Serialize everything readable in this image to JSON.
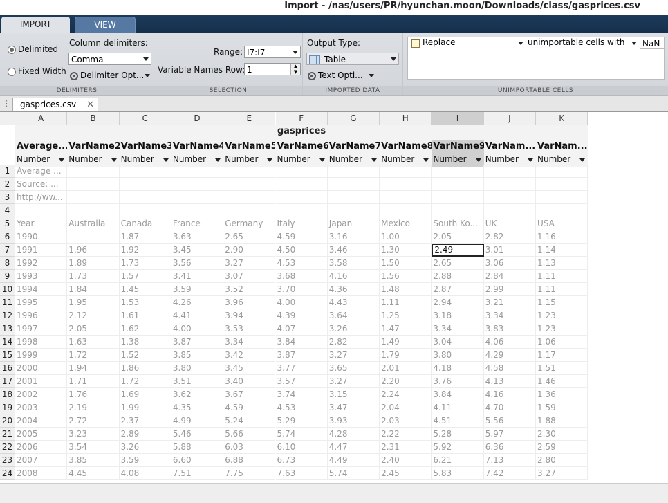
{
  "window": {
    "title": "Import - /nas/users/PR/hyunchan.moon/Downloads/class/gasprices.csv"
  },
  "tabs": [
    {
      "label": "IMPORT"
    },
    {
      "label": "VIEW"
    }
  ],
  "ribbon": {
    "delimiters": {
      "section_label": "DELIMITERS",
      "delimited_label": "Delimited",
      "fixed_width_label": "Fixed Width",
      "column_delimiters_label": "Column delimiters:",
      "column_delimiters_value": "Comma",
      "delimiter_options_label": "Delimiter Opt..."
    },
    "selection": {
      "section_label": "SELECTION",
      "range_label": "Range:",
      "range_value": "I7:I7",
      "var_names_row_label": "Variable Names Row:",
      "var_names_row_value": "1"
    },
    "imported_data": {
      "section_label": "IMPORTED DATA",
      "output_type_label": "Output Type:",
      "output_type_value": "Table",
      "text_options_label": "Text Opti..."
    },
    "unimportable": {
      "section_label": "UNIMPORTABLE CELLS",
      "replace_label": "Replace",
      "rule_label": "unimportable cells with",
      "value": "NaN"
    }
  },
  "document_tab": {
    "label": "gasprices.csv"
  },
  "grid": {
    "table_name": "gasprices",
    "columns": [
      "A",
      "B",
      "C",
      "D",
      "E",
      "F",
      "G",
      "H",
      "I",
      "J",
      "K"
    ],
    "selected_column": "I",
    "variable_names": [
      "Average...",
      "VarName2",
      "VarName3",
      "VarName4",
      "VarName5",
      "VarName6",
      "VarName7",
      "VarName8",
      "VarName9",
      "VarNam...",
      "VarNam..."
    ],
    "variable_types": [
      "Number",
      "Number",
      "Number",
      "Number",
      "Number",
      "Number",
      "Number",
      "Number",
      "Number",
      "Number",
      "Number"
    ],
    "selected_cell": "I7",
    "rows": [
      [
        "Average ...",
        "",
        "",
        "",
        "",
        "",
        "",
        "",
        "",
        "",
        ""
      ],
      [
        "Source: ...",
        "",
        "",
        "",
        "",
        "",
        "",
        "",
        "",
        "",
        ""
      ],
      [
        "http://ww...",
        "",
        "",
        "",
        "",
        "",
        "",
        "",
        "",
        "",
        ""
      ],
      [
        "",
        "",
        "",
        "",
        "",
        "",
        "",
        "",
        "",
        "",
        ""
      ],
      [
        "Year",
        "Australia",
        "Canada",
        "France",
        "Germany",
        "Italy",
        "Japan",
        "Mexico",
        "South Ko...",
        "UK",
        "USA"
      ],
      [
        "1990",
        "",
        "1.87",
        "3.63",
        "2.65",
        "4.59",
        "3.16",
        "1.00",
        "2.05",
        "2.82",
        "1.16"
      ],
      [
        "1991",
        "1.96",
        "1.92",
        "3.45",
        "2.90",
        "4.50",
        "3.46",
        "1.30",
        "2.49",
        "3.01",
        "1.14"
      ],
      [
        "1992",
        "1.89",
        "1.73",
        "3.56",
        "3.27",
        "4.53",
        "3.58",
        "1.50",
        "2.65",
        "3.06",
        "1.13"
      ],
      [
        "1993",
        "1.73",
        "1.57",
        "3.41",
        "3.07",
        "3.68",
        "4.16",
        "1.56",
        "2.88",
        "2.84",
        "1.11"
      ],
      [
        "1994",
        "1.84",
        "1.45",
        "3.59",
        "3.52",
        "3.70",
        "4.36",
        "1.48",
        "2.87",
        "2.99",
        "1.11"
      ],
      [
        "1995",
        "1.95",
        "1.53",
        "4.26",
        "3.96",
        "4.00",
        "4.43",
        "1.11",
        "2.94",
        "3.21",
        "1.15"
      ],
      [
        "1996",
        "2.12",
        "1.61",
        "4.41",
        "3.94",
        "4.39",
        "3.64",
        "1.25",
        "3.18",
        "3.34",
        "1.23"
      ],
      [
        "1997",
        "2.05",
        "1.62",
        "4.00",
        "3.53",
        "4.07",
        "3.26",
        "1.47",
        "3.34",
        "3.83",
        "1.23"
      ],
      [
        "1998",
        "1.63",
        "1.38",
        "3.87",
        "3.34",
        "3.84",
        "2.82",
        "1.49",
        "3.04",
        "4.06",
        "1.06"
      ],
      [
        "1999",
        "1.72",
        "1.52",
        "3.85",
        "3.42",
        "3.87",
        "3.27",
        "1.79",
        "3.80",
        "4.29",
        "1.17"
      ],
      [
        "2000",
        "1.94",
        "1.86",
        "3.80",
        "3.45",
        "3.77",
        "3.65",
        "2.01",
        "4.18",
        "4.58",
        "1.51"
      ],
      [
        "2001",
        "1.71",
        "1.72",
        "3.51",
        "3.40",
        "3.57",
        "3.27",
        "2.20",
        "3.76",
        "4.13",
        "1.46"
      ],
      [
        "2002",
        "1.76",
        "1.69",
        "3.62",
        "3.67",
        "3.74",
        "3.15",
        "2.24",
        "3.84",
        "4.16",
        "1.36"
      ],
      [
        "2003",
        "2.19",
        "1.99",
        "4.35",
        "4.59",
        "4.53",
        "3.47",
        "2.04",
        "4.11",
        "4.70",
        "1.59"
      ],
      [
        "2004",
        "2.72",
        "2.37",
        "4.99",
        "5.24",
        "5.29",
        "3.93",
        "2.03",
        "4.51",
        "5.56",
        "1.88"
      ],
      [
        "2005",
        "3.23",
        "2.89",
        "5.46",
        "5.66",
        "5.74",
        "4.28",
        "2.22",
        "5.28",
        "5.97",
        "2.30"
      ],
      [
        "2006",
        "3.54",
        "3.26",
        "5.88",
        "6.03",
        "6.10",
        "4.47",
        "2.31",
        "5.92",
        "6.36",
        "2.59"
      ],
      [
        "2007",
        "3.85",
        "3.59",
        "6.60",
        "6.88",
        "6.73",
        "4.49",
        "2.40",
        "6.21",
        "7.13",
        "2.80"
      ],
      [
        "2008",
        "4.45",
        "4.08",
        "7.51",
        "7.75",
        "7.63",
        "5.74",
        "2.45",
        "5.83",
        "7.42",
        "3.27"
      ]
    ]
  }
}
